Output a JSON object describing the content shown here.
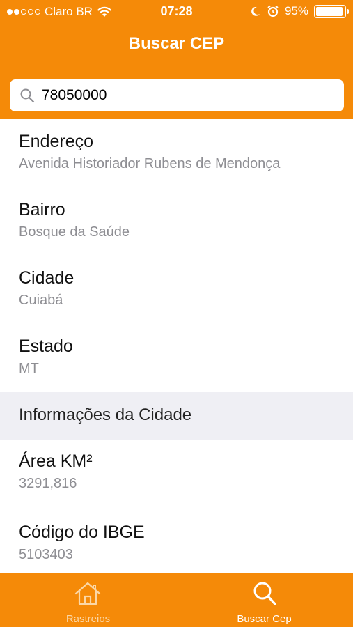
{
  "status_bar": {
    "carrier": "Claro BR",
    "time": "07:28",
    "battery_percent": "95%",
    "battery_level": 0.95,
    "signal_bars_filled": 2,
    "signal_bars_total": 5
  },
  "nav": {
    "title": "Buscar CEP"
  },
  "search": {
    "value": "78050000",
    "placeholder": ""
  },
  "fields": [
    {
      "label": "Endereço",
      "value": "Avenida Historiador Rubens de Mendonça"
    },
    {
      "label": "Bairro",
      "value": "Bosque da Saúde"
    },
    {
      "label": "Cidade",
      "value": "Cuiabá"
    },
    {
      "label": "Estado",
      "value": "MT"
    }
  ],
  "city_section": {
    "title": "Informações da Cidade",
    "fields": [
      {
        "label": "Área KM²",
        "value": "3291,816"
      },
      {
        "label": "Código do IBGE",
        "value": "5103403"
      }
    ]
  },
  "tab_bar": {
    "tabs": [
      {
        "label": "Rastreios",
        "icon": "home-icon",
        "active": false
      },
      {
        "label": "Buscar Cep",
        "icon": "search-icon",
        "active": true
      }
    ]
  },
  "colors": {
    "accent": "#f58a08",
    "secondary_text": "#8e8e93",
    "section_background": "#efeff4"
  }
}
